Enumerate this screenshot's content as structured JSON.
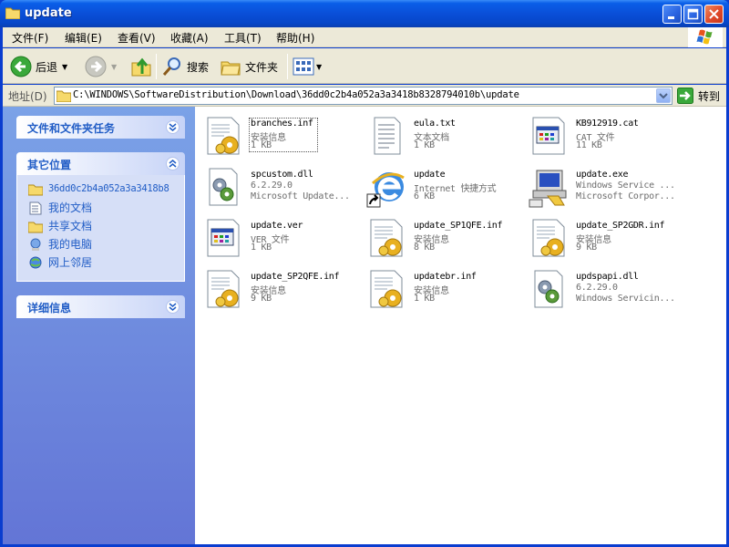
{
  "window": {
    "title": "update"
  },
  "menu": [
    {
      "label": "文件(F)"
    },
    {
      "label": "编辑(E)"
    },
    {
      "label": "查看(V)"
    },
    {
      "label": "收藏(A)"
    },
    {
      "label": "工具(T)"
    },
    {
      "label": "帮助(H)"
    }
  ],
  "toolbar": {
    "back_label": "后退",
    "search_label": "搜索",
    "folders_label": "文件夹"
  },
  "address": {
    "label": "地址(D)",
    "path": "C:\\WINDOWS\\SoftwareDistribution\\Download\\36dd0c2b4a052a3a3418b8328794010b\\update",
    "go_label": "转到"
  },
  "tasks": {
    "file_tasks": {
      "title": "文件和文件夹任务"
    },
    "other_places": {
      "title": "其它位置",
      "links": [
        {
          "label": "36dd0c2b4a052a3a3418b8",
          "icon": "folder-icon"
        },
        {
          "label": "我的文档",
          "icon": "documents-icon"
        },
        {
          "label": "共享文档",
          "icon": "folder-icon"
        },
        {
          "label": "我的电脑",
          "icon": "computer-icon"
        },
        {
          "label": "网上邻居",
          "icon": "network-icon"
        }
      ]
    },
    "details": {
      "title": "详细信息"
    }
  },
  "files": [
    {
      "name": "branches.inf",
      "line1": "安装信息",
      "line2": "1 KB",
      "icon": "inf-setup-icon"
    },
    {
      "name": "eula.txt",
      "line1": "文本文档",
      "line2": "1 KB",
      "icon": "text-document-icon"
    },
    {
      "name": "KB912919.cat",
      "line1": "CAT 文件",
      "line2": "11 KB",
      "icon": "generic-file-icon"
    },
    {
      "name": "spcustom.dll",
      "line1": "6.2.29.0",
      "line2": "Microsoft Update...",
      "icon": "dll-icon"
    },
    {
      "name": "update",
      "line1": "Internet 快捷方式",
      "line2": "6 KB",
      "icon": "internet-shortcut-icon"
    },
    {
      "name": "update.exe",
      "line1": "Windows Service ...",
      "line2": "Microsoft Corpor...",
      "icon": "exe-setup-icon"
    },
    {
      "name": "update.ver",
      "line1": "VER 文件",
      "line2": "1 KB",
      "icon": "generic-file-icon"
    },
    {
      "name": "update_SP1QFE.inf",
      "line1": "安装信息",
      "line2": "8 KB",
      "icon": "inf-setup-icon"
    },
    {
      "name": "update_SP2GDR.inf",
      "line1": "安装信息",
      "line2": "9 KB",
      "icon": "inf-setup-icon"
    },
    {
      "name": "update_SP2QFE.inf",
      "line1": "安装信息",
      "line2": "9 KB",
      "icon": "inf-setup-icon"
    },
    {
      "name": "updatebr.inf",
      "line1": "安装信息",
      "line2": "1 KB",
      "icon": "inf-setup-icon"
    },
    {
      "name": "updspapi.dll",
      "line1": "6.2.29.0",
      "line2": "Windows Servicin...",
      "icon": "dll-icon"
    }
  ]
}
